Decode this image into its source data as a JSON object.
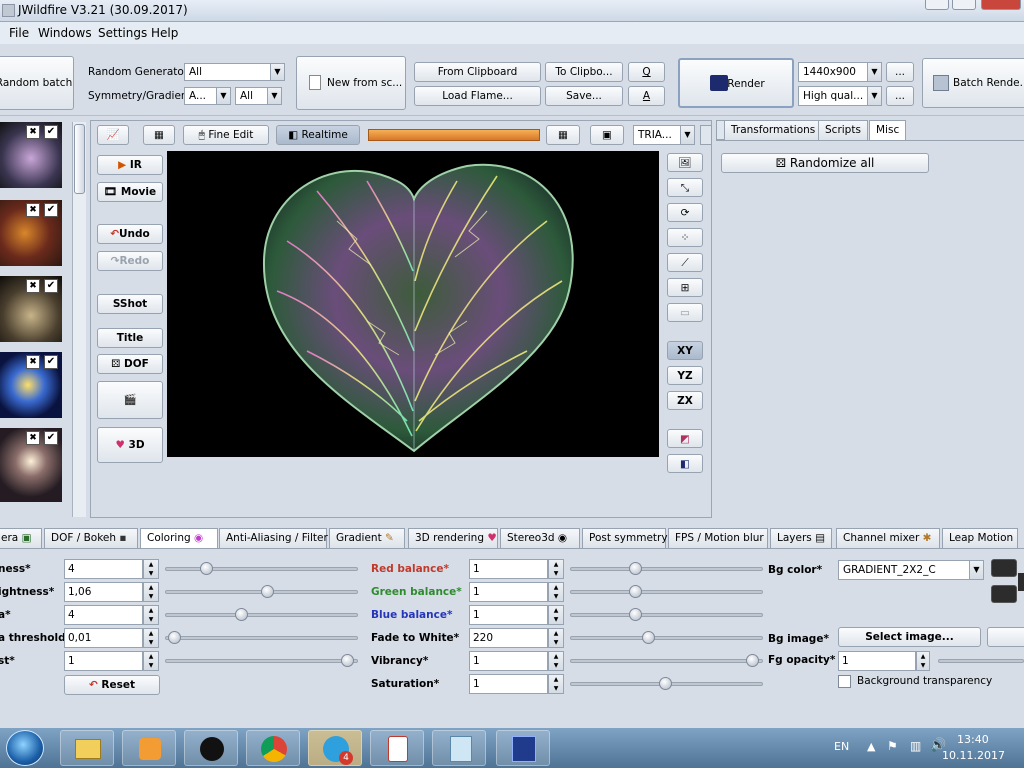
{
  "window": {
    "title": "JWildfire V3.21 (30.09.2017)"
  },
  "menu": [
    "File",
    "Windows",
    "Settings",
    "Help"
  ],
  "toolbar": {
    "random_batch": "Random batch",
    "random_generator_label": "Random Generator",
    "random_generator_value": "All",
    "symmetry_label": "Symmetry/Gradient",
    "symmetry_value": "A...",
    "gradient_value": "All",
    "new_from_script": "New from sc...",
    "from_clipboard": "From Clipboard",
    "to_clipboard": "To Clipbo...",
    "q": "Q",
    "load_flame": "Load Flame...",
    "save": "Save...",
    "a": "A",
    "render": "Render",
    "resolution": "1440x900",
    "quality": "High qual...",
    "ellipsis": "...",
    "batch_render": "Batch Rende..."
  },
  "editor_toolbar": {
    "fine_edit": "Fine Edit",
    "realtime": "Realtime",
    "tria": "TRIA..."
  },
  "left_buttons": {
    "ir": "IR",
    "movie": "Movie",
    "undo": "Undo",
    "redo": "Redo",
    "sshot": "SShot",
    "title": "Title",
    "dof": "DOF",
    "3d": "3D"
  },
  "right_icons": {
    "xy": "XY",
    "yz": "YZ",
    "zx": "ZX"
  },
  "right_panel": {
    "tabs": [
      "Transformations",
      "Scripts",
      "Misc"
    ],
    "randomize_all": "Randomize all"
  },
  "bottom_tabs": [
    "era",
    "DOF / Bokeh",
    "Coloring",
    "Anti-Aliasing / Filter",
    "Gradient",
    "3D rendering",
    "Stereo3d",
    "Post symmetry",
    "FPS / Motion blur",
    "Layers",
    "Channel mixer",
    "Leap Motion"
  ],
  "coloring": {
    "col1": [
      {
        "label": "ness*",
        "value": "4"
      },
      {
        "label": "ightness*",
        "value": "1,06"
      },
      {
        "label": "a*",
        "value": "4"
      },
      {
        "label": "a threshold*",
        "value": "0,01"
      },
      {
        "label": "st*",
        "value": "1"
      }
    ],
    "slider1_fracs": [
      0.22,
      0.55,
      0.41,
      0.05,
      0.98
    ],
    "reset": "Reset",
    "col2": [
      {
        "label": "Red balance*",
        "value": "1",
        "color": "#c0392b"
      },
      {
        "label": "Green balance*",
        "value": "1",
        "color": "#2e8b2e"
      },
      {
        "label": "Blue balance*",
        "value": "1",
        "color": "#2535b8"
      },
      {
        "label": "Fade to White*",
        "value": "220",
        "color": "#000000"
      },
      {
        "label": "Vibrancy*",
        "value": "1",
        "color": "#000000"
      },
      {
        "label": "Saturation*",
        "value": "1",
        "color": "#000000"
      }
    ],
    "slider2_fracs": [
      0.35,
      0.35,
      0.35,
      0.42,
      0.98,
      0.51
    ],
    "bg_color_label": "Bg color*",
    "bg_color_value": "GRADIENT_2X2_C",
    "bg_image_label": "Bg image*",
    "select_image": "Select image...",
    "fg_opacity_label": "Fg opacity*",
    "fg_opacity_value": "1",
    "bg_transparency": "Background transparency"
  },
  "taskbar": {
    "language": "EN",
    "time": "13:40",
    "date": "10.11.2017",
    "telegram_badge": "4"
  }
}
